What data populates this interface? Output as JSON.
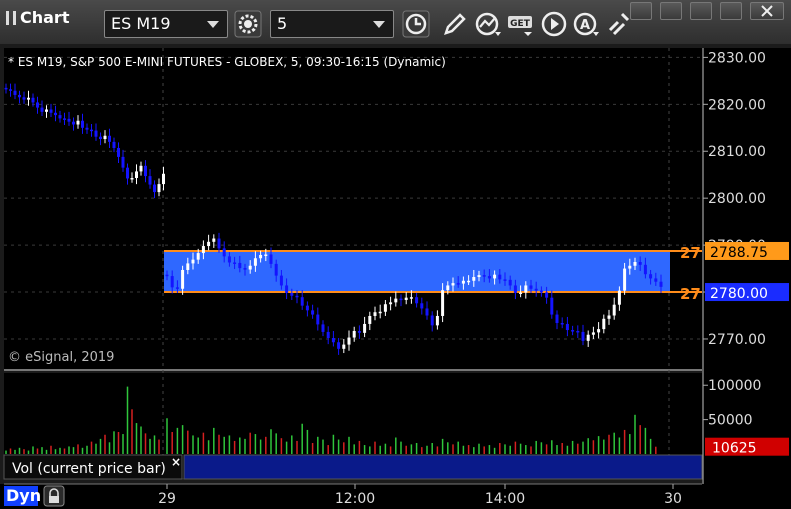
{
  "app": {
    "title": "Chart"
  },
  "toolbar": {
    "symbol": "ES M19",
    "interval": "5"
  },
  "chart_data": {
    "type": "candlestick",
    "title": "* ES M19, S&P 500 E-MINI FUTURES - GLOBEX, 5, 09:30-16:15 (Dynamic)",
    "watermark": "© eSignal, 2019",
    "y_ticks": [
      "2830.00",
      "2820.00",
      "2810.00",
      "2800.00",
      "2790.00",
      "2780.00",
      "2770.00"
    ],
    "y_tick_values": [
      2830,
      2820,
      2810,
      2800,
      2790,
      2780,
      2770
    ],
    "ylim": [
      2763.6,
      2832.0
    ],
    "x_labels": [
      "29",
      "12:00",
      "14:00",
      "30"
    ],
    "price_markers": [
      {
        "value": 2788.75,
        "label": "2788.75",
        "color": "#ff9a1a"
      },
      {
        "value": 2780.0,
        "label": "2780.00",
        "color": "#1a2cff"
      }
    ],
    "zone": {
      "high": 2788.75,
      "low": 2780.0,
      "left_label_high": "27",
      "left_label_low": "27"
    },
    "candles_session1": [
      2823.2,
      2822.9,
      2822.0,
      2821.5,
      2821.0,
      2821.4,
      2820.4,
      2819.3,
      2818.4,
      2818.9,
      2818.2,
      2817.7,
      2817.0,
      2816.9,
      2816.3,
      2815.7,
      2816.5,
      2815.0,
      2814.6,
      2814.4,
      2813.1,
      2812.6,
      2813.3,
      2812.0,
      2810.7,
      2808.8,
      2806.5,
      2804.2,
      2804.3,
      2805.7,
      2806.9,
      2804.7,
      2802.9,
      2801.3,
      2803.0,
      2805.2
    ],
    "candles_session2": [
      2783.4,
      2781.0,
      2780.7,
      2784.7,
      2786.1,
      2786.9,
      2788.3,
      2789.8,
      2790.7,
      2791.4,
      2789.3,
      2787.6,
      2786.3,
      2786.2,
      2785.1,
      2784.8,
      2785.6,
      2787.2,
      2787.9,
      2788.0,
      2786.0,
      2783.5,
      2781.4,
      2779.8,
      2779.2,
      2778.9,
      2777.1,
      2776.1,
      2775.2,
      2773.1,
      2771.5,
      2770.2,
      2769.3,
      2767.9,
      2768.8,
      2770.3,
      2771.7,
      2771.3,
      2773.2,
      2774.9,
      2775.7,
      2775.8,
      2777.4,
      2777.8,
      2778.6,
      2778.3,
      2778.8,
      2778.9,
      2777.6,
      2776.5,
      2775.0,
      2772.9,
      2774.9,
      2780.4,
      2781.4,
      2781.9,
      2781.8,
      2782.4,
      2782.4,
      2783.2,
      2783.6,
      2783.4,
      2782.9,
      2783.7,
      2782.7,
      2782.6,
      2781.4,
      2779.8,
      2779.9,
      2781.4,
      2780.7,
      2780.3,
      2779.9,
      2778.8,
      2775.2,
      2773.4,
      2773.2,
      2771.9,
      2771.7,
      2771.5,
      2769.6,
      2770.9,
      2771.4,
      2772.1,
      2774.3,
      2775.0,
      2777.3,
      2780.3,
      2785.0,
      2785.6,
      2786.4,
      2785.8,
      2783.8,
      2782.9,
      2782.2,
      2781.1
    ],
    "volume": {
      "y_ticks": [
        "100000",
        "50000"
      ],
      "y_tick_values": [
        100000,
        50000
      ],
      "ylim": [
        0,
        117800
      ],
      "current_value": "10625",
      "current_value_num": 10625,
      "label": "Vol (current price bar)",
      "values_session1": [
        5000,
        8000,
        6000,
        9000,
        7000,
        5000,
        11000,
        8000,
        10000,
        6000,
        12000,
        7000,
        9000,
        8000,
        11000,
        10000,
        14000,
        9000,
        12000,
        18000,
        15000,
        22000,
        28000,
        17000,
        33000,
        32000,
        29000,
        98000,
        65000,
        45000,
        40000,
        30000,
        22000,
        27000,
        21000
      ],
      "values_session2": [
        52000,
        32000,
        38000,
        42000,
        34000,
        27000,
        24000,
        31000,
        20000,
        38000,
        28000,
        25000,
        27000,
        19000,
        24000,
        22000,
        31000,
        29000,
        21000,
        25000,
        36000,
        30000,
        23000,
        18000,
        27000,
        19000,
        44000,
        35000,
        16000,
        25000,
        21000,
        13000,
        28000,
        21000,
        17000,
        25000,
        14000,
        19000,
        13000,
        11000,
        18000,
        12000,
        15000,
        11000,
        24000,
        18000,
        12000,
        14000,
        16000,
        10000,
        12000,
        16000,
        11000,
        22000,
        17000,
        14000,
        18000,
        12000,
        13000,
        10000,
        15000,
        11000,
        13000,
        9000,
        16000,
        14000,
        12000,
        18000,
        15000,
        13000,
        11000,
        19000,
        17000,
        14000,
        20000,
        13000,
        16000,
        12000,
        19000,
        15000,
        18000,
        23000,
        20000,
        26000,
        21000,
        28000,
        31000,
        24000,
        35000,
        29000,
        57000,
        42000,
        38000,
        22000,
        10625
      ]
    }
  },
  "footer": {
    "dyn_label": "Dyn"
  },
  "colors": {
    "up": "#ffffff",
    "down": "#1414ff",
    "zone": "#2f68ff",
    "zone_border": "#ff8c1a",
    "vol_up": "#2fc63c",
    "vol_down": "#d62020"
  }
}
